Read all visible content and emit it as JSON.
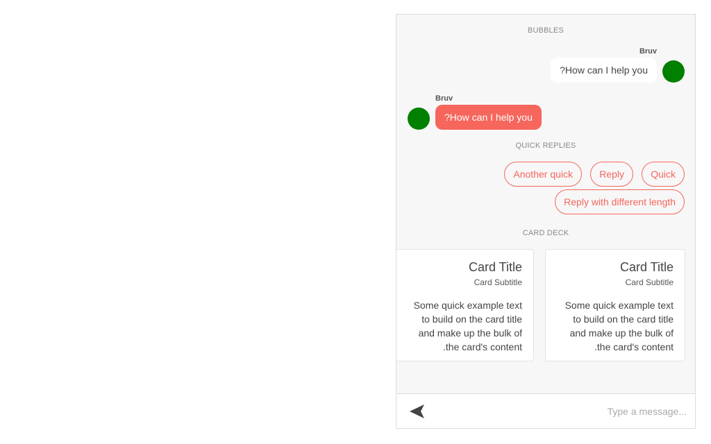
{
  "sections": {
    "bubbles": "BUBBLES",
    "quick_replies": "QUICK REPLIES",
    "card_deck": "CARD DECK"
  },
  "messages": [
    {
      "sender": "Bruv",
      "text": "?How can I help you",
      "style": "incoming-white"
    },
    {
      "sender": "Bruv",
      "text": "?How can I help you",
      "style": "outgoing-coral"
    }
  ],
  "quick_replies": [
    "Quick",
    "Reply",
    "Another quick",
    "Reply with different length"
  ],
  "cards": [
    {
      "title": "Card Title",
      "subtitle": "Card Subtitle",
      "text": "Some quick example text to build on the card title and make up the bulk of the card's content."
    },
    {
      "title": "Card Title",
      "subtitle": "Card Subtitle",
      "text": "Some quick example text to build on the card title and make up the bulk of the card's content."
    }
  ],
  "composer": {
    "placeholder": "...Type a message",
    "send_icon": "send-icon"
  },
  "colors": {
    "accent": "#f6665c",
    "avatar": "#008000",
    "panel_bg": "#f7f7f7"
  }
}
